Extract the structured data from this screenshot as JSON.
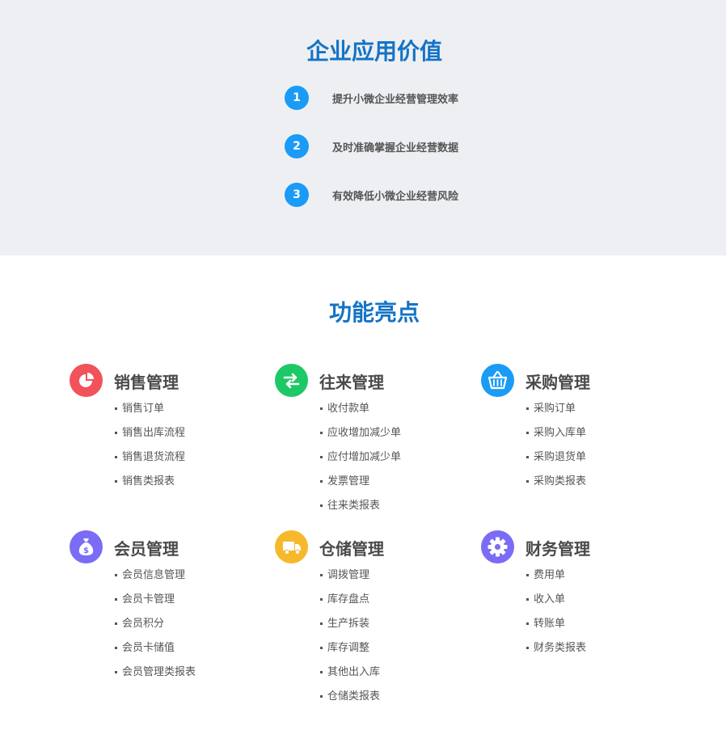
{
  "value_section": {
    "title": "企业应用价值",
    "items": [
      {
        "num": "1",
        "text": "提升小微企业经营管理效率"
      },
      {
        "num": "2",
        "text": "及时准确掌握企业经营数据"
      },
      {
        "num": "3",
        "text": "有效降低小微企业经营风险"
      }
    ]
  },
  "feature_section": {
    "title": "功能亮点",
    "features": [
      {
        "name": "销售管理",
        "icon": "pie-chart-icon",
        "color": "#f2525a",
        "items": [
          "销售订单",
          "销售出库流程",
          "销售退货流程",
          "销售类报表"
        ]
      },
      {
        "name": "往来管理",
        "icon": "exchange-arrows-icon",
        "color": "#1dc866",
        "items": [
          "收付款单",
          "应收增加减少单",
          "应付增加减少单",
          "发票管理",
          "往来类报表"
        ]
      },
      {
        "name": "采购管理",
        "icon": "basket-icon",
        "color": "#1a9bf6",
        "items": [
          "采购订单",
          "采购入库单",
          "采购退货单",
          "采购类报表"
        ]
      },
      {
        "name": "会员管理",
        "icon": "money-bag-icon",
        "color": "#7b6cf5",
        "items": [
          "会员信息管理",
          "会员卡管理",
          "会员积分",
          "会员卡储值",
          "会员管理类报表"
        ]
      },
      {
        "name": "仓储管理",
        "icon": "truck-icon",
        "color": "#f7b92c",
        "items": [
          "调拨管理",
          "库存盘点",
          "生产拆装",
          "库存调整",
          "其他出入库",
          "仓储类报表"
        ]
      },
      {
        "name": "财务管理",
        "icon": "gear-icon",
        "color": "#7b6cf5",
        "items": [
          "费用单",
          "收入单",
          "转账单",
          "财务类报表"
        ]
      }
    ]
  }
}
